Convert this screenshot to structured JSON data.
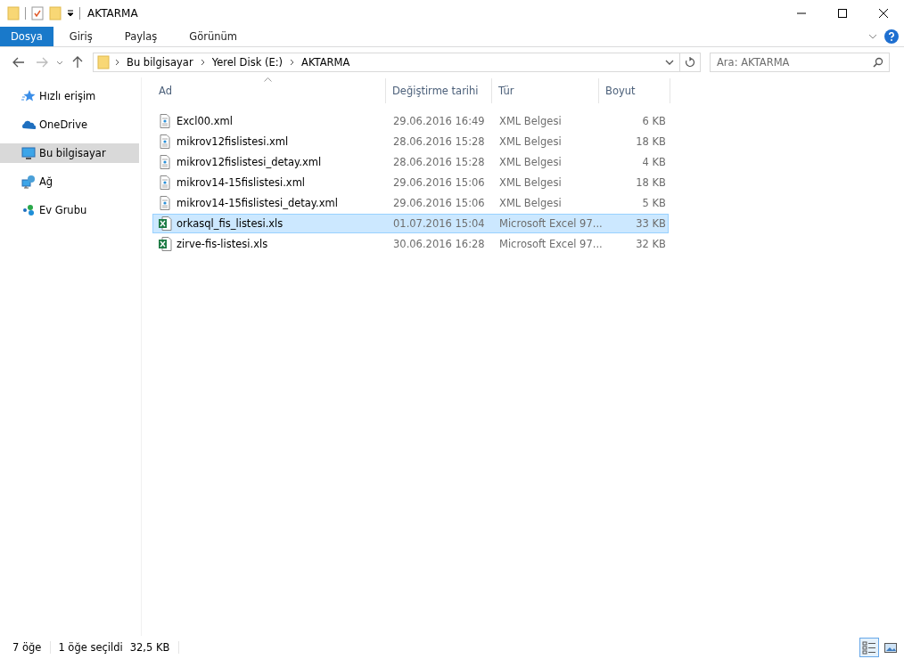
{
  "window": {
    "title": "AKTARMA"
  },
  "ribbon_tabs": [
    {
      "label": "Dosya",
      "selected": true
    },
    {
      "label": "Giriş",
      "selected": false
    },
    {
      "label": "Paylaş",
      "selected": false
    },
    {
      "label": "Görünüm",
      "selected": false
    }
  ],
  "address": {
    "crumbs": [
      "Bu bilgisayar",
      "Yerel Disk (E:)",
      "AKTARMA"
    ]
  },
  "search": {
    "placeholder": "Ara: AKTARMA"
  },
  "sidebar": {
    "items": [
      {
        "label": "Hızlı erişim",
        "kind": "star",
        "selected": false
      },
      {
        "label": "OneDrive",
        "kind": "cloud",
        "selected": false
      },
      {
        "label": "Bu bilgisayar",
        "kind": "pc",
        "selected": true
      },
      {
        "label": "Ağ",
        "kind": "network",
        "selected": false
      },
      {
        "label": "Ev Grubu",
        "kind": "homegroup",
        "selected": false
      }
    ]
  },
  "table": {
    "columns": [
      "Ad",
      "Değiştirme tarihi",
      "Tür",
      "Boyut"
    ],
    "rows": [
      {
        "name": "Excl00.xml",
        "kind": "xml",
        "date": "29.06.2016 16:49",
        "type": "XML Belgesi",
        "size": "6 KB",
        "selected": false
      },
      {
        "name": "mikrov12fislistesi.xml",
        "kind": "xml",
        "date": "28.06.2016 15:28",
        "type": "XML Belgesi",
        "size": "18 KB",
        "selected": false
      },
      {
        "name": "mikrov12fislistesi_detay.xml",
        "kind": "xml",
        "date": "28.06.2016 15:28",
        "type": "XML Belgesi",
        "size": "4 KB",
        "selected": false
      },
      {
        "name": "mikrov14-15fislistesi.xml",
        "kind": "xml",
        "date": "29.06.2016 15:06",
        "type": "XML Belgesi",
        "size": "18 KB",
        "selected": false
      },
      {
        "name": "mikrov14-15fislistesi_detay.xml",
        "kind": "xml",
        "date": "29.06.2016 15:06",
        "type": "XML Belgesi",
        "size": "5 KB",
        "selected": false
      },
      {
        "name": "orkasql_fis_listesi.xls",
        "kind": "xls",
        "date": "01.07.2016 15:04",
        "type": "Microsoft Excel 97...",
        "size": "33 KB",
        "selected": true
      },
      {
        "name": "zirve-fis-listesi.xls",
        "kind": "xls",
        "date": "30.06.2016 16:28",
        "type": "Microsoft Excel 97...",
        "size": "32 KB",
        "selected": false
      }
    ]
  },
  "status_bar": {
    "count": "7 öğe",
    "selection": "1 öğe seçildi",
    "selection_size": "32,5 KB",
    "views": [
      {
        "kind": "details",
        "selected": true
      },
      {
        "kind": "thumbnails",
        "selected": false
      }
    ]
  }
}
